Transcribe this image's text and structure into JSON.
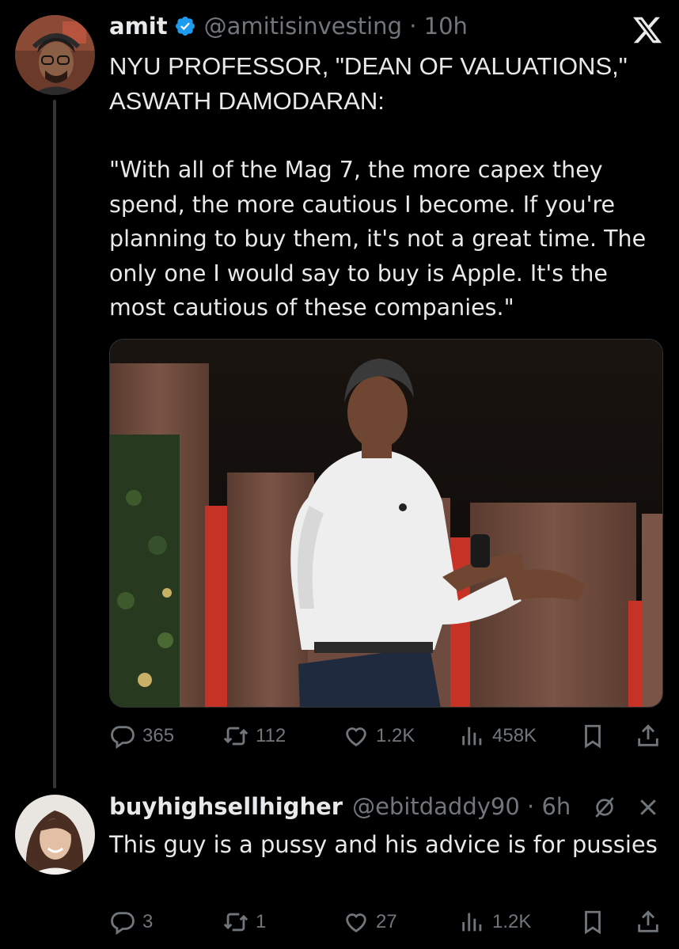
{
  "tweet": {
    "author_name": "amit",
    "handle_time": "@amitisinvesting · 10h",
    "headline": "NYU PROFESSOR, \"DEAN OF VALUATIONS,\" ASWATH DAMODARAN:",
    "body": "\"With all of the Mag 7, the more capex they spend, the more cautious I become. If you're planning to buy them, it's not a great time. The only one I would say to buy is Apple. It's the most cautious of these companies.\"",
    "stats": {
      "replies": "365",
      "reposts": "112",
      "likes": "1.2K",
      "views": "458K"
    }
  },
  "reply": {
    "author_name": "buyhighsellhigher",
    "handle_time": "@ebitdaddy90 · 6h",
    "body": "This guy is a pussy and his advice is for pussies",
    "stats": {
      "replies": "3",
      "reposts": "1",
      "likes": "27",
      "views": "1.2K"
    }
  },
  "icons": [
    "x-logo-icon",
    "verified-badge-icon",
    "reply-icon",
    "repost-icon",
    "like-icon",
    "views-icon",
    "bookmark-icon",
    "share-icon",
    "grok-icon",
    "close-icon"
  ],
  "colors": {
    "background": "#000000",
    "text": "#e7e9ea",
    "muted": "#71767b",
    "verified": "#1d9bf0"
  }
}
